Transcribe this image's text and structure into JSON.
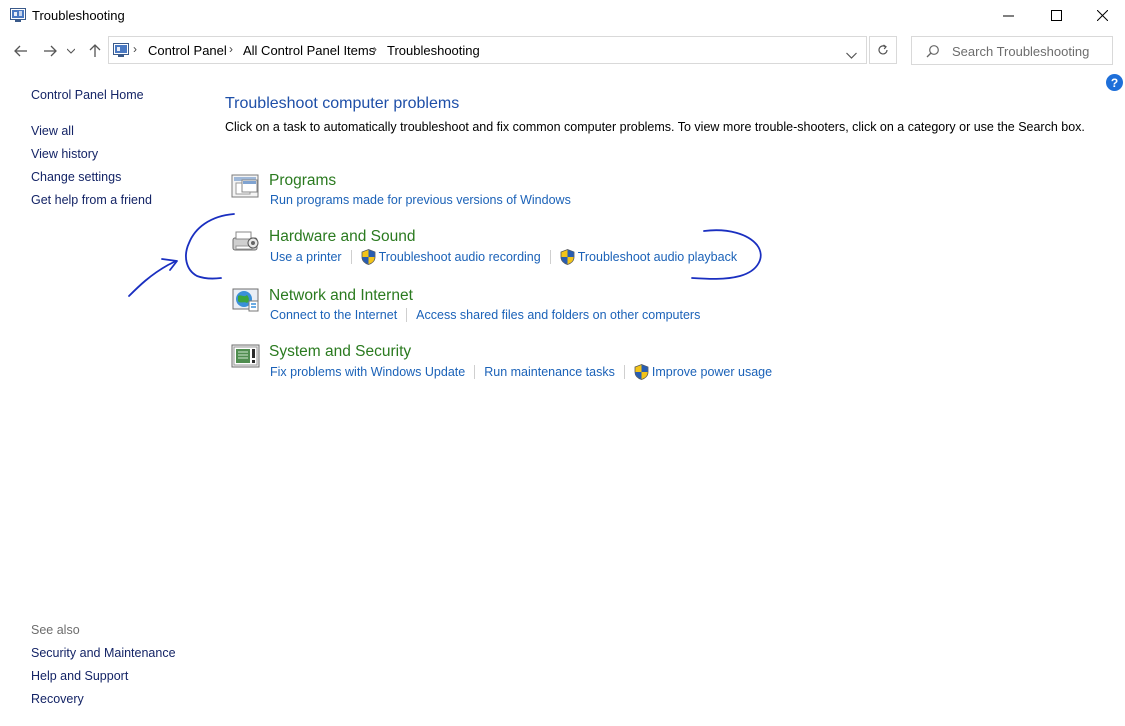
{
  "window": {
    "title": "Troubleshooting"
  },
  "breadcrumb": [
    "Control Panel",
    "All Control Panel Items",
    "Troubleshooting"
  ],
  "search": {
    "placeholder": "Search Troubleshooting"
  },
  "help": {
    "label": "?"
  },
  "left_pane": {
    "home": "Control Panel Home",
    "links": [
      "View all",
      "View history",
      "Change settings",
      "Get help from a friend"
    ],
    "see_also_heading": "See also",
    "see_also": [
      "Security and Maintenance",
      "Help and Support",
      "Recovery"
    ]
  },
  "main": {
    "heading": "Troubleshoot computer problems",
    "description": "Click on a task to automatically troubleshoot and fix common computer problems. To view more trouble-shooters, click on a category or use the Search box.",
    "categories": [
      {
        "title": "Programs",
        "icon": "programs-icon",
        "tasks": [
          {
            "label": "Run programs made for previous versions of Windows",
            "shield": false
          }
        ]
      },
      {
        "title": "Hardware and Sound",
        "icon": "hardware-sound-icon",
        "tasks": [
          {
            "label": "Use a printer",
            "shield": false
          },
          {
            "label": "Troubleshoot audio recording",
            "shield": true
          },
          {
            "label": "Troubleshoot audio playback",
            "shield": true
          }
        ]
      },
      {
        "title": "Network and Internet",
        "icon": "network-internet-icon",
        "tasks": [
          {
            "label": "Connect to the Internet",
            "shield": false
          },
          {
            "label": "Access shared files and folders on other computers",
            "shield": false
          }
        ]
      },
      {
        "title": "System and Security",
        "icon": "system-security-icon",
        "tasks": [
          {
            "label": "Fix problems with Windows Update",
            "shield": false
          },
          {
            "label": "Run maintenance tasks",
            "shield": false
          },
          {
            "label": "Improve power usage",
            "shield": true
          }
        ]
      }
    ]
  },
  "colors": {
    "heading_blue": "#1e4fa8",
    "category_green": "#2a7a1f",
    "link_blue": "#1b62b8",
    "annotation_ink": "#1a2fc0"
  }
}
